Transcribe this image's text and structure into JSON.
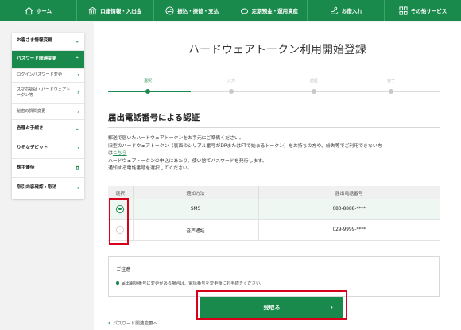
{
  "top_nav": [
    {
      "label": "ホーム",
      "icon": "home-icon"
    },
    {
      "label": "口座情報・入出金",
      "icon": "bank-icon"
    },
    {
      "label": "振込・振替・支払",
      "icon": "transfer-icon"
    },
    {
      "label": "定期預金・運用資産",
      "icon": "piggy-bank-icon"
    },
    {
      "label": "お借入れ",
      "icon": "loan-icon"
    },
    {
      "label": "その他サービス",
      "icon": "grid-icon"
    }
  ],
  "sidebar": {
    "items": [
      {
        "label": "お客さま情報変更",
        "chevron": "⌄"
      },
      {
        "label": "パスワード関連変更",
        "chevron": "⌃"
      },
      {
        "label": "ログインパスワード変更",
        "chevron": "›"
      },
      {
        "label": "スマホ認証・ハードウェアトークン等",
        "chevron": "›"
      },
      {
        "label": "秘密の質問変更",
        "chevron": "›"
      },
      {
        "label": "各種お手続き",
        "chevron": "⌄"
      },
      {
        "label": "りそなデビット",
        "chevron": "›"
      },
      {
        "label": "株主優待",
        "chevron": "⧉"
      },
      {
        "label": "取引内容確認・取消",
        "chevron": "›"
      }
    ]
  },
  "page": {
    "title": "ハードウェアトークン利用開始登録",
    "steps": [
      {
        "label": "選択",
        "current": true
      },
      {
        "label": "入力",
        "current": false
      },
      {
        "label": "認証",
        "current": false
      },
      {
        "label": "完了",
        "current": false
      }
    ],
    "section_title": "届出電話番号による認証",
    "desc": {
      "line1": "郵送で届いたハードウェアトークンをお手元にご準備ください。",
      "line2": "旧型のハードウェアトークン（裏面のシリアル番号がDPまたはFTで始まるトークン）をお持ちの方や、紛失等でご利用できない方",
      "line3_prefix": "は",
      "line3_link": "こちら",
      "line4": "ハードウェアトークンの申込にあたり、使い捨てパスワードを発行します。",
      "line5": "通知する電話番号を選択してください。"
    }
  },
  "table": {
    "headers": [
      "選択",
      "通知方法",
      "届出電話番号"
    ],
    "rows": [
      {
        "method": "SMS",
        "phone": "080-8888-****",
        "selected": true
      },
      {
        "method": "音声通話",
        "phone": "029-9999-****",
        "selected": false
      }
    ]
  },
  "notice": {
    "title": "ご注意",
    "text": "届出電話番号に変更がある場合は、電話番号を変更後にお手続きください。"
  },
  "actions": {
    "back_label": "パスワード関連変更へ",
    "submit_label": "受取る"
  },
  "colors": {
    "brand_green": "#1a8a4c",
    "highlight_red": "#d9001b"
  }
}
